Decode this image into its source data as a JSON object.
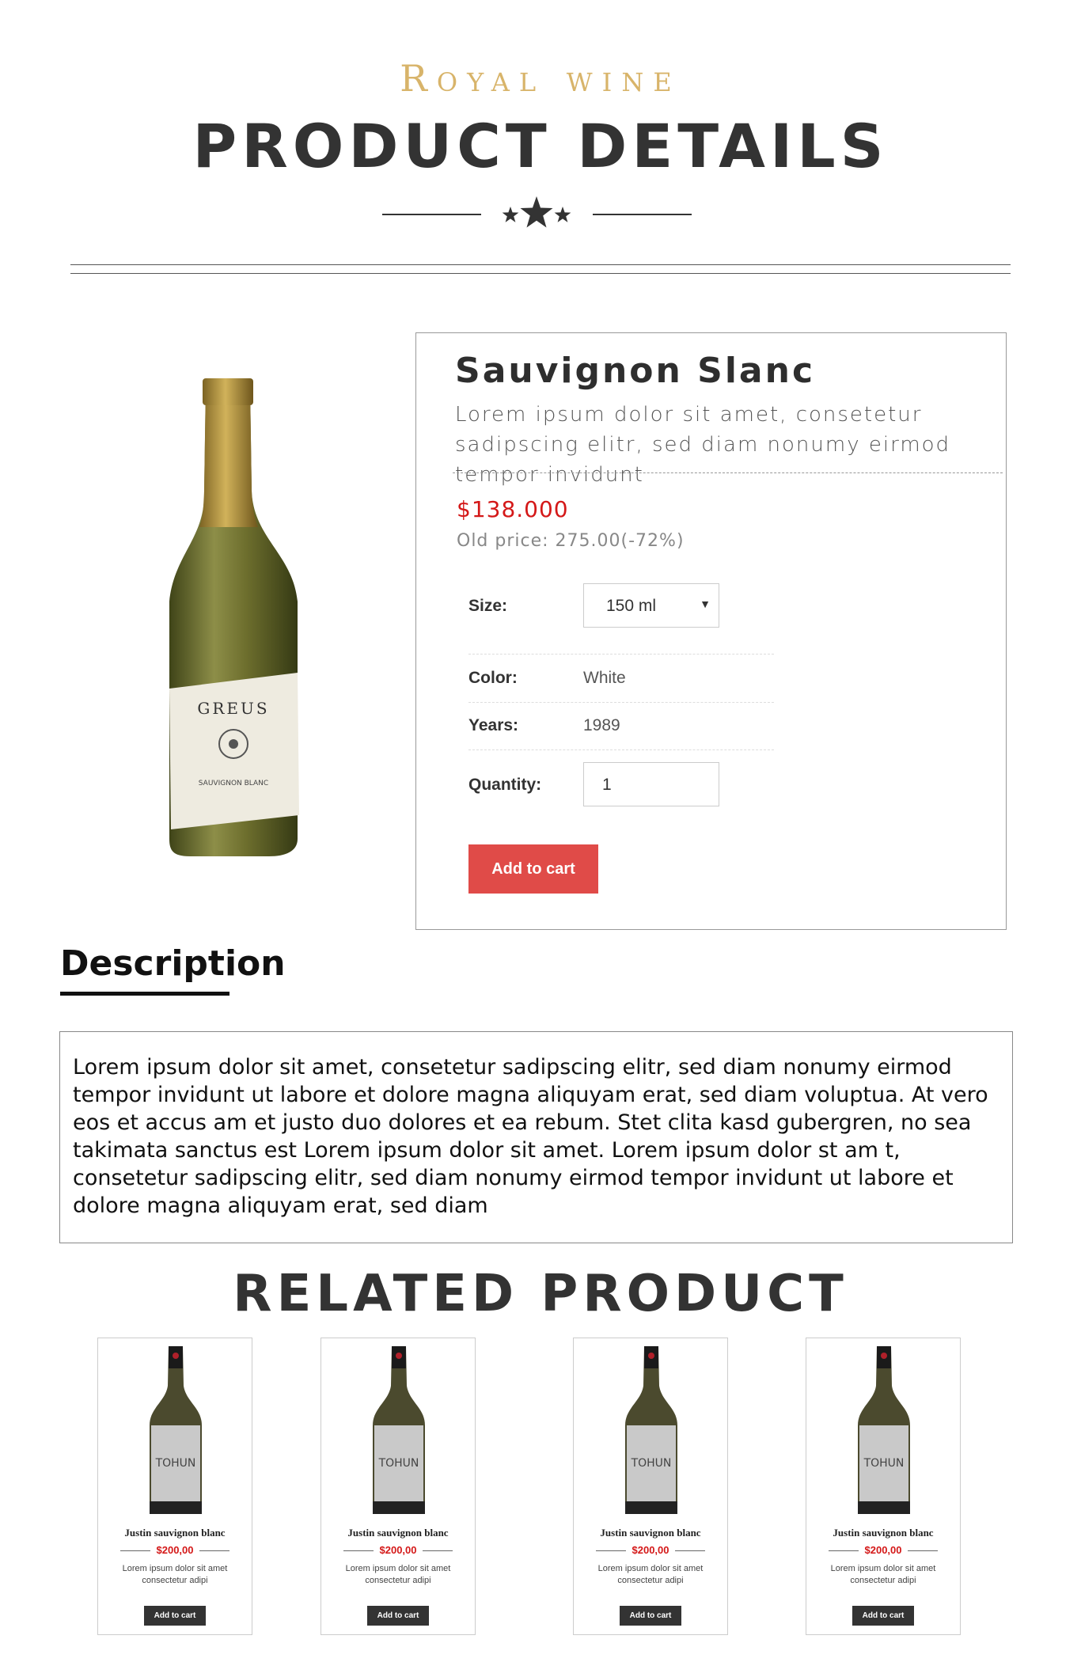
{
  "header": {
    "brand": "Royal wine",
    "title": "PRODUCT DETAILS",
    "ornament_icon": "three-stars-icon"
  },
  "product": {
    "image_icon": "wine-bottle-icon",
    "name": "Sauvignon Slanc",
    "description": "Lorem ipsum dolor sit amet, consetetur sadipscing elitr, sed diam nonumy eirmod tempor invidunt",
    "price": "$138.000",
    "old_price": "Old price: 275.00(-72%)",
    "size_label": "Size:",
    "size_value": "150 ml",
    "color_label": "Color:",
    "color_value": "White",
    "years_label": "Years:",
    "years_value": "1989",
    "quantity_label": "Quantity:",
    "quantity_value": "1",
    "add_to_cart": "Add to cart",
    "label_text": "GREUS",
    "label_sub": "SAUVIGNON BLANC"
  },
  "description": {
    "heading": "Description",
    "text": "Lorem ipsum dolor sit amet, consetetur sadipscing elitr, sed diam nonumy eirmod tempor invidunt ut labore et dolore magna aliquyam erat, sed diam voluptua. At vero eos et accus am et justo duo dolores et ea rebum. Stet clita kasd gubergren, no sea takimata sanctus est Lorem ipsum dolor sit amet. Lorem ipsum dolor st am t, consetetur sadipscing elitr, sed diam nonumy eirmod tempor invidunt ut labore et dolore magna aliquyam erat, sed diam"
  },
  "related": {
    "title": "RELATED PRODUCT",
    "items": [
      {
        "name": "Justin sauvignon blanc",
        "price": "$200,00",
        "desc": "Lorem ipsum dolor sit amet consectetur adipi",
        "button": "Add to cart",
        "label": "TOHUN"
      },
      {
        "name": "Justin sauvignon blanc",
        "price": "$200,00",
        "desc": "Lorem ipsum dolor sit amet consectetur adipi",
        "button": "Add to cart",
        "label": "TOHUN"
      },
      {
        "name": "Justin sauvignon blanc",
        "price": "$200,00",
        "desc": "Lorem ipsum dolor sit amet consectetur adipi",
        "button": "Add to cart",
        "label": "TOHUN"
      },
      {
        "name": "Justin sauvignon blanc",
        "price": "$200,00",
        "desc": "Lorem ipsum dolor sit amet consectetur adipi",
        "button": "Add to cart",
        "label": "TOHUN"
      }
    ]
  },
  "colors": {
    "brand_gold": "#d8b46a",
    "price_red": "#d41818",
    "button_red": "#e04b48",
    "text_dark": "#333333"
  }
}
